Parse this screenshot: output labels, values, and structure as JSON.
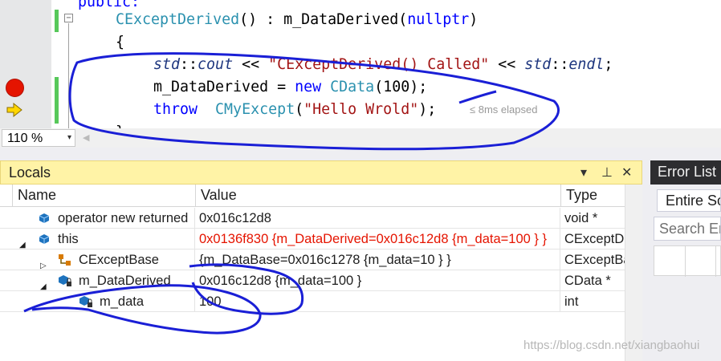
{
  "editor": {
    "line0_text": "public:",
    "line1": {
      "class_name": "CExceptDerived",
      "sig": "() : ",
      "member": "m_DataDerived",
      "arg": "nullptr",
      "close": ")"
    },
    "line2_text": "{",
    "line3": {
      "ns1": "std",
      "sep1": "::",
      "cout": "cout",
      "op1": " << ",
      "str": "\"CExceptDerived() Called\"",
      "op2": " << ",
      "ns2": "std",
      "sep2": "::",
      "endl": "endl",
      "end": ";"
    },
    "line4": {
      "lhs": "m_DataDerived = ",
      "kw_new": "new",
      "sp": " ",
      "type": "CData",
      "args": "(100);"
    },
    "line5": {
      "kw_throw": "throw",
      "sp": "  ",
      "type": "CMyExcept",
      "open": "(",
      "str": "\"Hello Wrold\"",
      "close": ");"
    },
    "line6_text": "}",
    "elapsed": "≤ 8ms elapsed",
    "fold_glyph": "−",
    "breakpoint_icon": "breakpoint-icon",
    "instruction_pointer_icon": "instruction-pointer-icon"
  },
  "zoom": {
    "value": "110 %",
    "arrow": "▾",
    "scroll_left": "◀"
  },
  "locals": {
    "title": "Locals",
    "controls": {
      "dropdown": "▾",
      "pin": "⊥",
      "close": "✕"
    },
    "columns": {
      "name": "Name",
      "value": "Value",
      "type": "Type"
    },
    "rows": [
      {
        "name": "operator new returned",
        "value": "0x016c12d8",
        "type": "void *"
      },
      {
        "name": "this",
        "value": "0x0136f830 {m_DataDerived=0x016c12d8 {m_data=100 } }",
        "type": "CExceptDerived *"
      },
      {
        "name": "CExceptBase",
        "value": "{m_DataBase=0x016c1278 {m_data=10 } }",
        "type": "CExceptBase"
      },
      {
        "name": "m_DataDerived",
        "value": "0x016c12d8 {m_data=100 }",
        "type": "CData *"
      },
      {
        "name": "m_data",
        "value": "100",
        "type": "int"
      }
    ],
    "expand_collapsed": "▷",
    "expand_open": "◢"
  },
  "error_list": {
    "title": "Error List",
    "scope": "Entire Solution",
    "search_placeholder": "Search Error List"
  },
  "watermark": "https://blog.csdn.net/xiangbaohui",
  "colors": {
    "keyword": "#0000ff",
    "type": "#2b91af",
    "string": "#a31515",
    "changed_value": "#e51400",
    "tool_header": "#fff3a6",
    "annotation_ink": "#1a1fd6"
  }
}
